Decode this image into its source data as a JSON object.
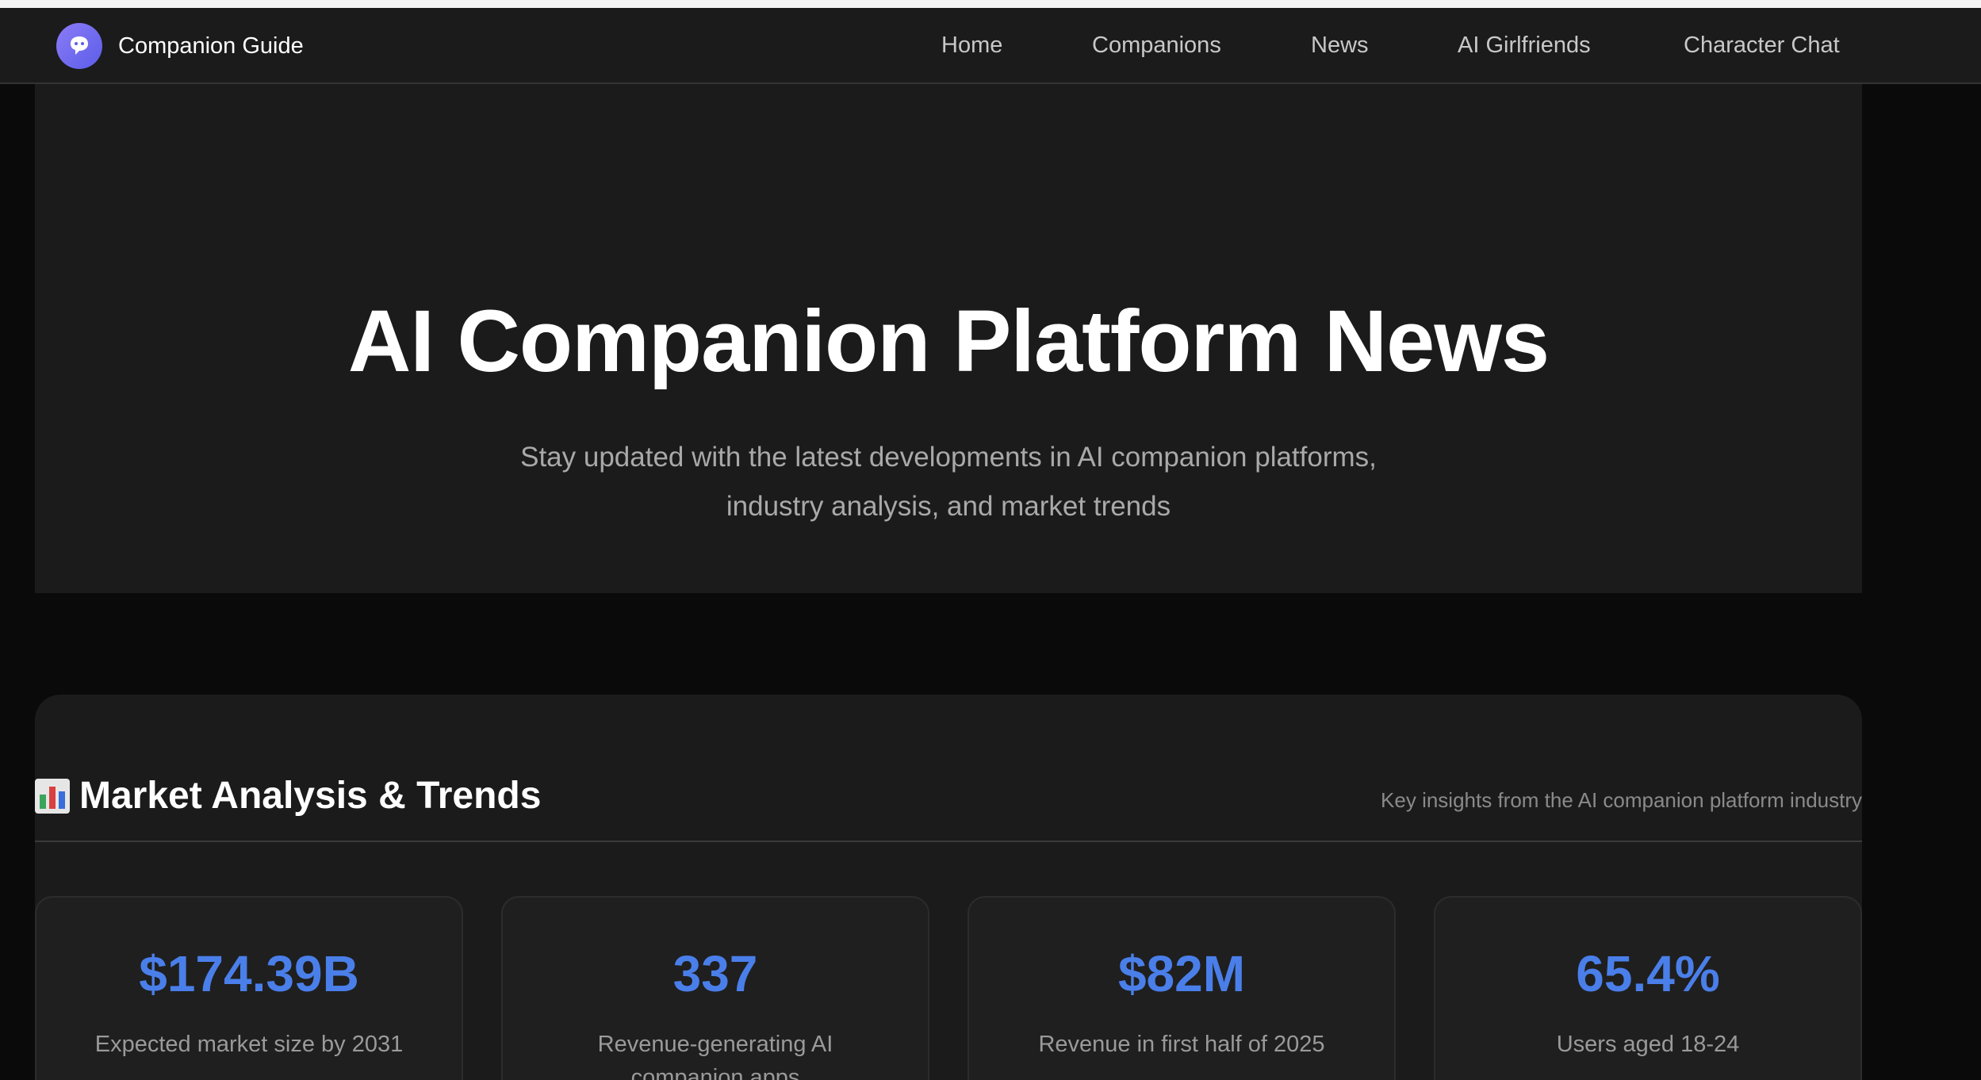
{
  "brand": {
    "name": "Companion Guide",
    "logo_icon": "chat-bubble-icon"
  },
  "nav": {
    "items": [
      {
        "label": "Home"
      },
      {
        "label": "Companions"
      },
      {
        "label": "News"
      },
      {
        "label": "AI Girlfriends"
      },
      {
        "label": "Character Chat"
      }
    ]
  },
  "hero": {
    "title": "AI Companion Platform News",
    "subtitle_line1": "Stay updated with the latest developments in AI companion platforms,",
    "subtitle_line2": "industry analysis, and market trends"
  },
  "market": {
    "icon": "bar-chart-icon",
    "title": "Market Analysis & Trends",
    "note": "Key insights from the AI companion platform industry",
    "stats": [
      {
        "value": "$174.39B",
        "label": "Expected market size by 2031"
      },
      {
        "value": "337",
        "label": "Revenue-generating AI companion apps"
      },
      {
        "value": "$82M",
        "label": "Revenue in first half of 2025"
      },
      {
        "value": "65.4%",
        "label": "Users aged 18-24"
      }
    ]
  },
  "colors": {
    "accent": "#4a7fea",
    "background": "#0a0a0a",
    "panel": "#1b1b1b"
  }
}
